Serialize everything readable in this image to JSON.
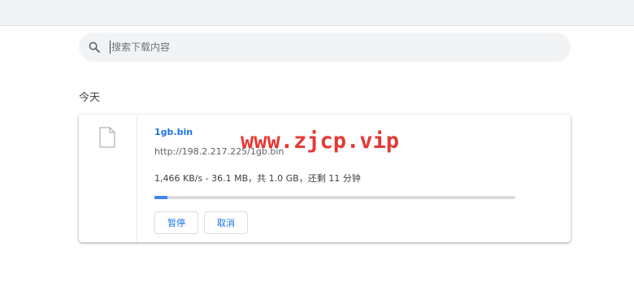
{
  "search": {
    "placeholder": "搜索下载内容"
  },
  "section": {
    "date_label": "今天"
  },
  "download": {
    "file_name": "1gb.bin",
    "url": "http://198.2.217.225/1gb.bin",
    "progress_text": "1,466 KB/s - 36.1 MB，共 1.0 GB，还剩 11 分钟",
    "progress_fraction": 0.035,
    "pause_label": "暂停",
    "cancel_label": "取消"
  },
  "watermark": {
    "text": "www.zjcp.vip"
  },
  "colors": {
    "accent": "#1a73e8",
    "progress": "#4285f4",
    "watermark": "#e53935"
  },
  "icons": {
    "search": "search-icon",
    "file": "file-icon"
  }
}
